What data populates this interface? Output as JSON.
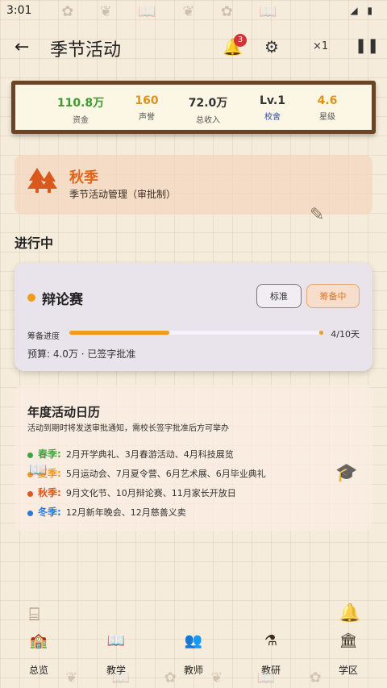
{
  "status": {
    "time": "3:01",
    "icons": "◢ ▮"
  },
  "header": {
    "title": "季节活动",
    "notification_count": "3",
    "speed": "×1"
  },
  "stats": [
    {
      "value": "110.8万",
      "label": "资金",
      "color": "#3e9a2e"
    },
    {
      "value": "160",
      "label": "声誉",
      "color": "#e39218"
    },
    {
      "value": "72.0万",
      "label": "总收入",
      "color": "#333333"
    },
    {
      "value": "Lv.1",
      "label": "校舍",
      "color": "#333333",
      "label_color": "#2a4aa8"
    },
    {
      "value": "4.6",
      "label": "星级",
      "color": "#e39218"
    }
  ],
  "season": {
    "name": "秋季",
    "subtitle": "季节活动管理（审批制）"
  },
  "section": {
    "in_progress": "进行中"
  },
  "event": {
    "name": "辩论赛",
    "btn_standard": "标准",
    "btn_preparing": "筹备中",
    "progress_label": "筹备进度",
    "progress_value": 0.4,
    "progress_count": "4/10天",
    "budget": "预算: 4.0万 · 已签字批准"
  },
  "calendar": {
    "title": "年度活动日历",
    "note": "活动到期时将发送审批通知，需校长签字批准后方可举办",
    "rows": [
      {
        "season": "春季:",
        "events": "2月开学典礼、3月春游活动、4月科技展览",
        "color": "#3ea83e"
      },
      {
        "season": "夏季:",
        "events": "5月运动会、7月夏令营、6月艺术展、6月毕业典礼",
        "color": "#f29a1a"
      },
      {
        "season": "秋季:",
        "events": "9月文化节、10月辩论赛、11月家长开放日",
        "color": "#e0561c"
      },
      {
        "season": "冬季:",
        "events": "12月新年晚会、12月慈善义卖",
        "color": "#2a78d8"
      }
    ]
  },
  "nav": [
    {
      "label": "总览",
      "icon": "school-icon"
    },
    {
      "label": "教学",
      "icon": "book-icon"
    },
    {
      "label": "教师",
      "icon": "teachers-icon"
    },
    {
      "label": "教研",
      "icon": "flask-icon"
    },
    {
      "label": "学区",
      "icon": "district-icon"
    }
  ]
}
